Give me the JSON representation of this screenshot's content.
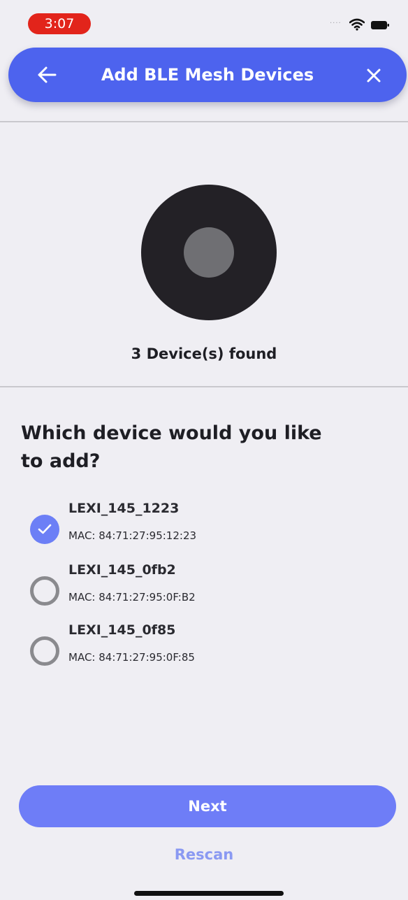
{
  "status_bar": {
    "time": "3:07",
    "signal": "....",
    "icons": [
      "wifi-icon",
      "battery-icon"
    ]
  },
  "header": {
    "title": "Add BLE Mesh Devices",
    "back_icon": "arrow-left-icon",
    "close_icon": "close-icon"
  },
  "scan": {
    "found_text": "3 Device(s) found"
  },
  "question": "Which device would you like to add?",
  "devices": [
    {
      "name": "LEXI_145_1223",
      "mac": "MAC: 84:71:27:95:12:23",
      "selected": true
    },
    {
      "name": "LEXI_145_0fb2",
      "mac": "MAC: 84:71:27:95:0F:B2",
      "selected": false
    },
    {
      "name": "LEXI_145_0f85",
      "mac": "MAC: 84:71:27:95:0F:85",
      "selected": false
    }
  ],
  "actions": {
    "next_label": "Next",
    "rescan_label": "Rescan"
  },
  "colors": {
    "accent": "#4d63ee",
    "button": "#6e7df7",
    "link": "#8a99f2",
    "time_pill": "#e2241b",
    "background": "#efeef3"
  }
}
